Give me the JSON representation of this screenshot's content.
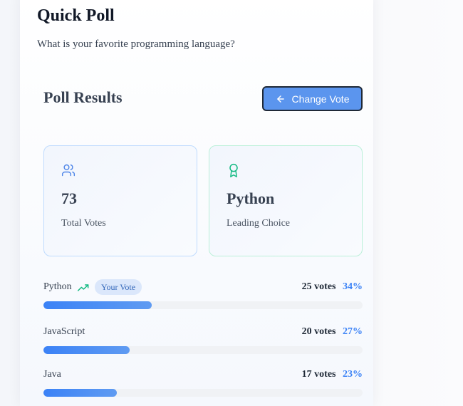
{
  "poll": {
    "title": "Quick Poll",
    "question": "What is your favorite programming language?"
  },
  "results": {
    "title": "Poll Results",
    "change_vote_label": "Change Vote",
    "change_vote_icon": "arrow-left-icon"
  },
  "stats": {
    "total_votes": {
      "icon": "users-icon",
      "value": "73",
      "label": "Total Votes"
    },
    "leading": {
      "icon": "award-icon",
      "value": "Python",
      "label": "Leading Choice"
    }
  },
  "options": [
    {
      "name": "Python",
      "trend_icon": "trending-up-icon",
      "badge": "Your Vote",
      "votes": "25 votes",
      "percent_label": "34%",
      "percent": 34
    },
    {
      "name": "JavaScript",
      "votes": "20 votes",
      "percent_label": "27%",
      "percent": 27
    },
    {
      "name": "Java",
      "votes": "17 votes",
      "percent_label": "23%",
      "percent": 23
    }
  ],
  "colors": {
    "accent": "#3b82f6",
    "button": "#5b95ee",
    "badge_bg": "#dbe7fb",
    "trend": "#10b981",
    "leader_icon": "#10b981"
  }
}
